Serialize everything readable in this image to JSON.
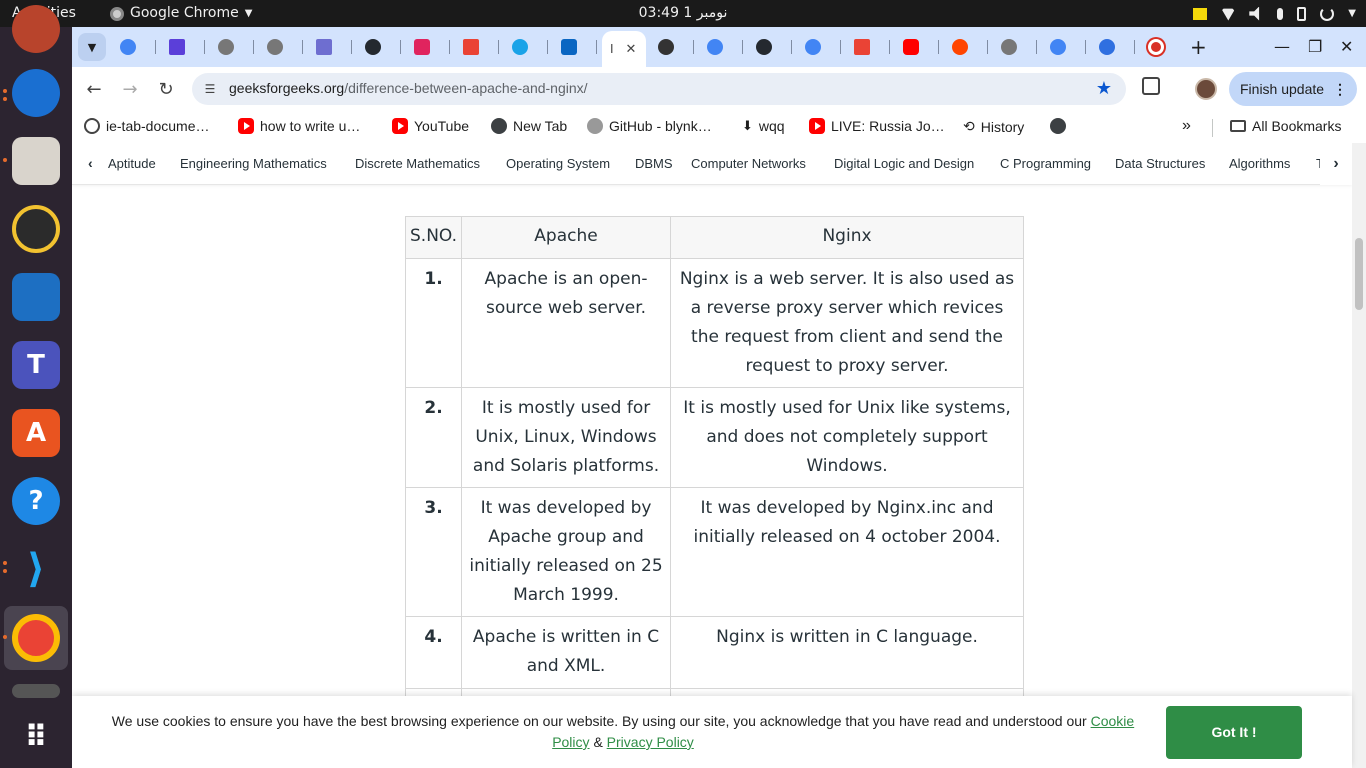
{
  "system": {
    "activities": "Activities",
    "app_name": "Google Chrome",
    "clock": "03:49 نومبر 1"
  },
  "browser": {
    "url_domain": "geeksforgeeks.org",
    "url_path": "/difference-between-apache-and-nginx/",
    "finish_update": "Finish update",
    "bookmarks": [
      {
        "label": "ie-tab-docume…",
        "icon": "page-icon"
      },
      {
        "label": "how to write u…",
        "icon": "youtube-icon"
      },
      {
        "label": "YouTube",
        "icon": "youtube-icon"
      },
      {
        "label": "New Tab",
        "icon": "globe-icon"
      },
      {
        "label": "GitHub - blynk…",
        "icon": "github-icon"
      },
      {
        "label": "wqq",
        "icon": "download-icon"
      },
      {
        "label": "LIVE: Russia Jo…",
        "icon": "youtube-icon"
      },
      {
        "label": "History",
        "icon": "history-icon"
      }
    ],
    "all_bookmarks": "All Bookmarks"
  },
  "subnav": {
    "items": [
      "Aptitude",
      "Engineering Mathematics",
      "Discrete Mathematics",
      "Operating System",
      "DBMS",
      "Computer Networks",
      "Digital Logic and Design",
      "C Programming",
      "Data Structures",
      "Algorithms",
      "T"
    ]
  },
  "table": {
    "headers": [
      "S.NO.",
      "Apache",
      "Nginx"
    ],
    "rows": [
      [
        "1.",
        "Apache is an open-source web server.",
        "Nginx is a web server. It is also used as a reverse proxy server which revices the request from client and send the request to proxy server."
      ],
      [
        "2.",
        "It is mostly used for Unix, Linux, Windows and Solaris platforms.",
        "It is mostly used for Unix like systems, and does not completely support Windows."
      ],
      [
        "3.",
        "It was developed by Apache group and initially released on 25 March 1999.",
        "It was developed by Nginx.inc and initially released on 4 october 2004."
      ],
      [
        "4.",
        "Apache is written in C and XML.",
        "Nginx is written in C language."
      ]
    ]
  },
  "cookie": {
    "text": "We use cookies to ensure you have the best browsing experience on our website. By using our site, you acknowledge that you have read and understood our",
    "cookie_policy": "Cookie Policy",
    "amp": "&",
    "privacy_policy": "Privacy Policy",
    "button": "Got It !"
  },
  "colors": {
    "accent_green": "#2f8d46",
    "tabstrip": "#d3e3fd"
  }
}
